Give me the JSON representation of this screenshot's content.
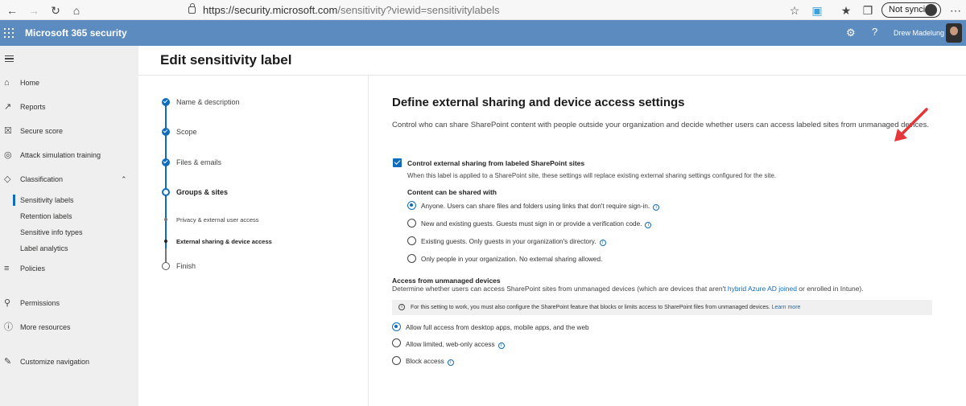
{
  "browser": {
    "url_host": "https://security.microsoft.com",
    "url_path": "/sensitivity?viewid=sensitivitylabels",
    "sync_label": "Not syncing"
  },
  "topbar": {
    "app_title": "Microsoft 365 security",
    "user_name": "Drew Madelung"
  },
  "sidebar": {
    "items": [
      {
        "label": "Home",
        "icon": "home-icon"
      },
      {
        "label": "Reports",
        "icon": "chart-icon"
      },
      {
        "label": "Secure score",
        "icon": "trophy-icon"
      },
      {
        "label": "Attack simulation training",
        "icon": "target-icon"
      },
      {
        "label": "Classification",
        "icon": "tag-icon"
      },
      {
        "label": "Sensitivity labels"
      },
      {
        "label": "Retention labels"
      },
      {
        "label": "Sensitive info types"
      },
      {
        "label": "Label analytics"
      },
      {
        "label": "Policies",
        "icon": "sliders-icon"
      },
      {
        "label": "Permissions",
        "icon": "key-icon"
      },
      {
        "label": "More resources",
        "icon": "info-icon"
      },
      {
        "label": "Customize navigation",
        "icon": "pencil-icon"
      }
    ]
  },
  "page": {
    "title": "Edit sensitivity label"
  },
  "wizard": {
    "steps": [
      "Name & description",
      "Scope",
      "Files & emails",
      "Groups & sites",
      "Privacy & external user access",
      "External sharing & device access",
      "Finish"
    ]
  },
  "content": {
    "heading": "Define external sharing and device access settings",
    "description": "Control who can share SharePoint content with people outside your organization and decide whether users can access labeled sites from unmanaged devices.",
    "checkbox_label": "Control external sharing from labeled SharePoint sites",
    "checkbox_checked": true,
    "checkbox_note": "When this label is applied to a SharePoint site, these settings will replace existing external sharing settings configured for the site.",
    "sharing_heading": "Content can be shared with",
    "sharing_options": [
      "Anyone. Users can share files and folders using links that don't require sign-in.",
      "New and existing guests. Guests must sign in or provide a verification code.",
      "Existing guests. Only guests in your organization's directory.",
      "Only people in your organization. No external sharing allowed."
    ],
    "sharing_selected_index": 0,
    "access_heading": "Access from unmanaged devices",
    "access_desc_a": "Determine whether users can access SharePoint sites from unmanaged devices (which are devices that aren't ",
    "access_desc_link": "hybrid Azure AD joined",
    "access_desc_b": " or enrolled in Intune).",
    "banner_text": "For this setting to work, you must also configure the SharePoint feature that blocks or limits access to SharePoint files from unmanaged devices.",
    "banner_link": "Learn more",
    "access_options": [
      "Allow full access from desktop apps, mobile apps, and the web",
      "Allow limited, web-only access",
      "Block access"
    ],
    "access_selected_index": 0
  },
  "colors": {
    "accent": "#0f6cbd",
    "topbar": "#5b8bbf",
    "annotation_arrow": "#e5363a"
  }
}
